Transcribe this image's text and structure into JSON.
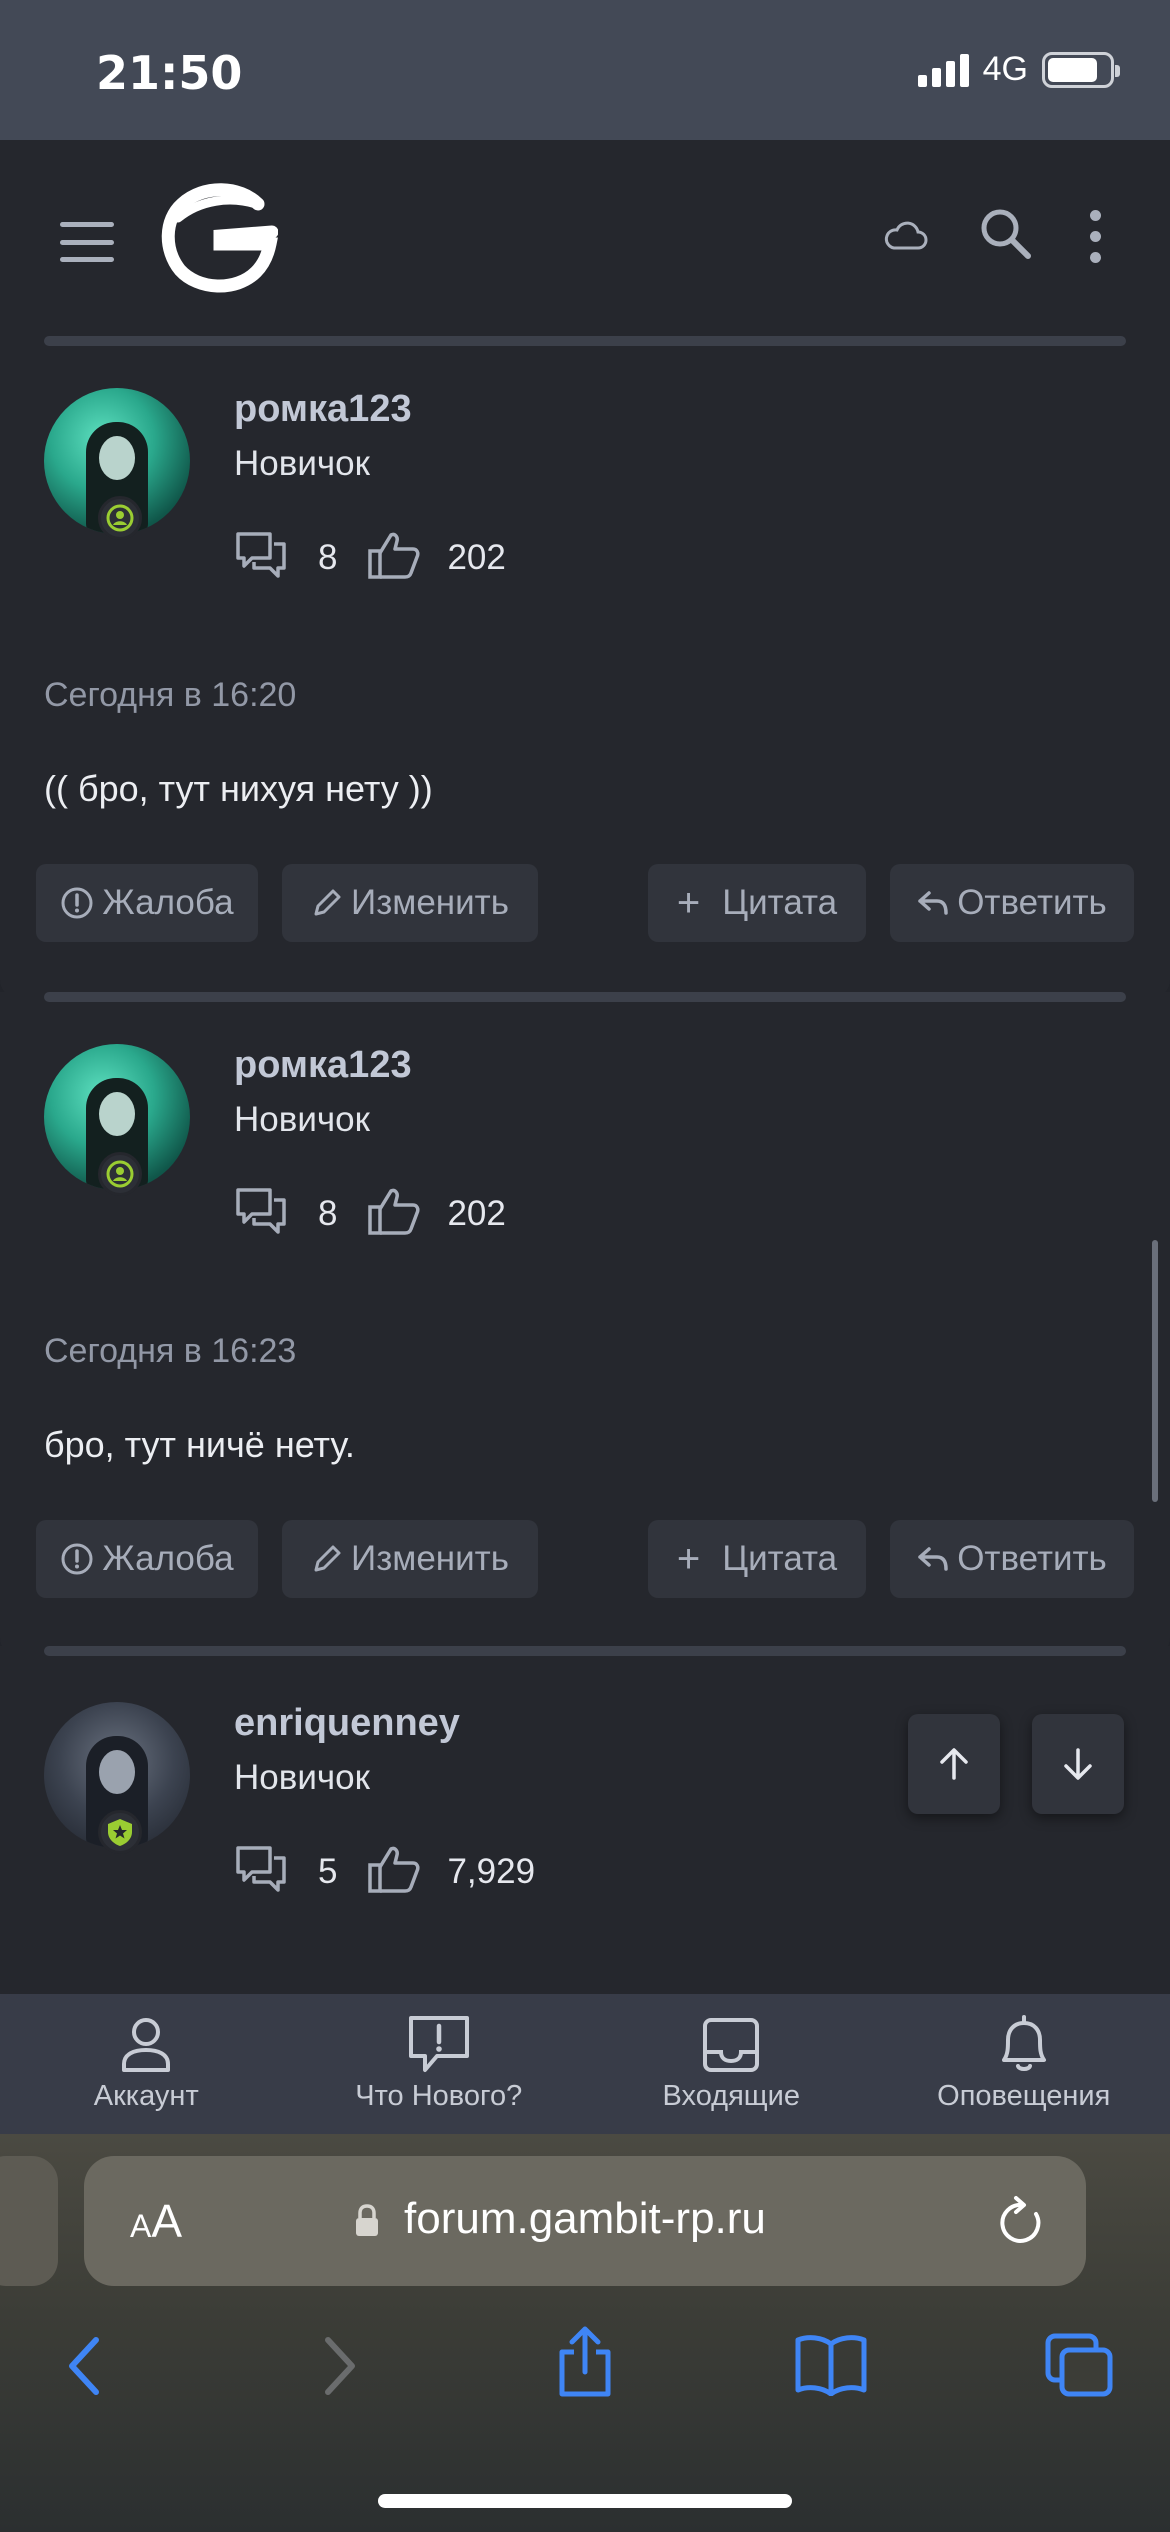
{
  "status_bar": {
    "time": "21:50",
    "network": "4G",
    "battery_level": 0.82
  },
  "header": {
    "logo": "G",
    "icons": [
      "menu-icon",
      "cloud-icon",
      "search-icon",
      "more-icon"
    ]
  },
  "posts": [
    {
      "username": "ромка123",
      "user_title": "Новичок",
      "messages": "8",
      "reactions": "202",
      "date": "Сегодня в 16:20",
      "text": "(( бро, тут нихуя нету ))",
      "actions": {
        "report": "Жалоба",
        "edit": "Изменить",
        "quote": "Цитата",
        "reply": "Ответить"
      }
    },
    {
      "username": "ромка123",
      "user_title": "Новичок",
      "messages": "8",
      "reactions": "202",
      "date": "Сегодня в 16:23",
      "text": "бро, тут ничё нету.",
      "actions": {
        "report": "Жалоба",
        "edit": "Изменить",
        "quote": "Цитата",
        "reply": "Ответить"
      }
    },
    {
      "username": "enriquenney",
      "user_title": "Новичок",
      "messages": "5",
      "reactions": "7,929"
    }
  ],
  "bottom_nav": [
    {
      "label": "Аккаунт",
      "icon": "user-icon"
    },
    {
      "label": "Что Нового?",
      "icon": "whats-new-icon"
    },
    {
      "label": "Входящие",
      "icon": "inbox-icon"
    },
    {
      "label": "Оповещения",
      "icon": "bell-icon"
    }
  ],
  "browser": {
    "text_size_label": "AA",
    "url": "forum.gambit-rp.ru"
  },
  "colors": {
    "accent_badge": "#9acd32",
    "button_bg": "#31343c",
    "username": "#c2c8d6"
  }
}
